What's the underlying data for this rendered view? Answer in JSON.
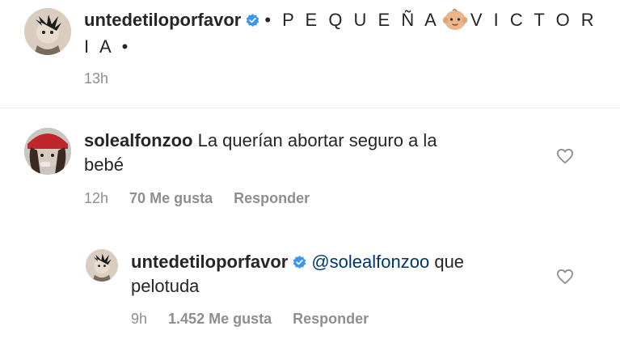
{
  "caption": {
    "username": "untedetiloporfavor",
    "text_part1": "• P E Q U E Ñ A",
    "emoji": "baby-face-emoji",
    "text_part2": "V I C T O R",
    "text_line2": "I A •",
    "time": "13h"
  },
  "comment": {
    "username": "solealfonzoo",
    "text_line1": "La querían abortar seguro a la",
    "text_line2": "bebé",
    "time": "12h",
    "likes": "70 Me gusta",
    "reply_label": "Responder"
  },
  "reply": {
    "username": "untedetiloporfavor",
    "mention": "@solealfonzoo",
    "text_line1": " que",
    "text_line2": "pelotuda",
    "time": "9h",
    "likes": "1.452 Me gusta",
    "reply_label": "Responder"
  },
  "colors": {
    "verified": "#3897f0",
    "mention": "#00376b",
    "meta": "#8e8e8e"
  }
}
